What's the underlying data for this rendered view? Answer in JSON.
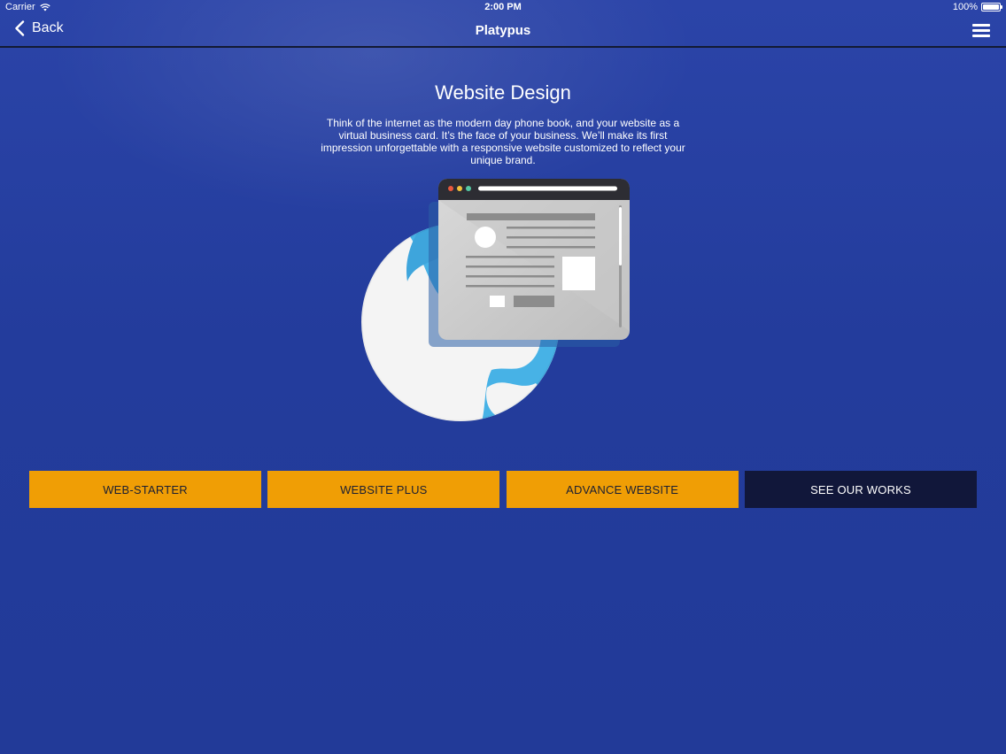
{
  "status_bar": {
    "carrier": "Carrier",
    "time": "2:00 PM",
    "battery": "100%"
  },
  "nav": {
    "back_label": "Back",
    "title": "Platypus"
  },
  "main": {
    "title": "Website Design",
    "description": "Think of the internet as the modern day phone book, and your website as a virtual business card. It’s the face of your business. We’ll make its first impression unforgettable with a responsive website customized to reflect your unique brand."
  },
  "buttons": [
    {
      "label": "WEB-STARTER"
    },
    {
      "label": "WEBSITE PLUS"
    },
    {
      "label": "ADVANCE WEBSITE"
    },
    {
      "label": "SEE OUR WORKS"
    }
  ],
  "colors": {
    "background": "#233c9c",
    "accent": "#f09e05",
    "dark_button": "#11173a"
  },
  "icons": [
    "wifi-icon",
    "battery-icon",
    "back-chevron-icon",
    "hamburger-menu-icon",
    "globe-browser-illustration"
  ]
}
